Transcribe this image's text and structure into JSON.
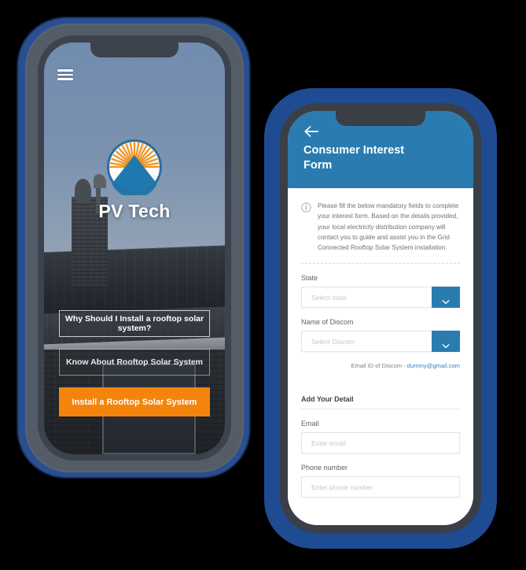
{
  "phone_home": {
    "menu_icon": "hamburger-menu-icon",
    "logo_icon": "pv-tech-sun-roof-logo",
    "app_title": "PV Tech",
    "buttons": [
      {
        "label": "Why Should I Install a rooftop solar system?",
        "style": "outline"
      },
      {
        "label": "Know About Rooftop Solar System",
        "style": "outline"
      },
      {
        "label": "Install a Rooftop Solar System",
        "style": "primary"
      }
    ]
  },
  "phone_form": {
    "back_icon": "back-arrow-icon",
    "header_title": "Consumer Interest Form",
    "info_icon": "info-circle-icon",
    "info_text": "Please fill the below mandatory fields to complete your interest form. Based on the details provided, your local electricity distribution company will contact you to guide and assist you in the Grid Connected Rooftop Solar System installation.",
    "fields": {
      "state": {
        "label": "State",
        "placeholder": "Select state",
        "dropdown_icon": "chevron-down-icon"
      },
      "discom": {
        "label": "Name of Discom",
        "placeholder": "Select Discom",
        "dropdown_icon": "chevron-down-icon"
      }
    },
    "discom_email_label": "Email ID of Discom - ",
    "discom_email_value": "dummy@gmail.com",
    "section_title": "Add Your Detail",
    "email": {
      "label": "Email",
      "placeholder": "Enter email"
    },
    "phone": {
      "label": "Phone number",
      "placeholder": "Enter phone number"
    }
  },
  "colors": {
    "brand_blue": "#2a7cb0",
    "accent_orange": "#f5840c",
    "frame_blue": "#1f4b93",
    "link_blue": "#2b86cf",
    "logo_orange": "#f0941f",
    "logo_blue": "#2079ae"
  }
}
